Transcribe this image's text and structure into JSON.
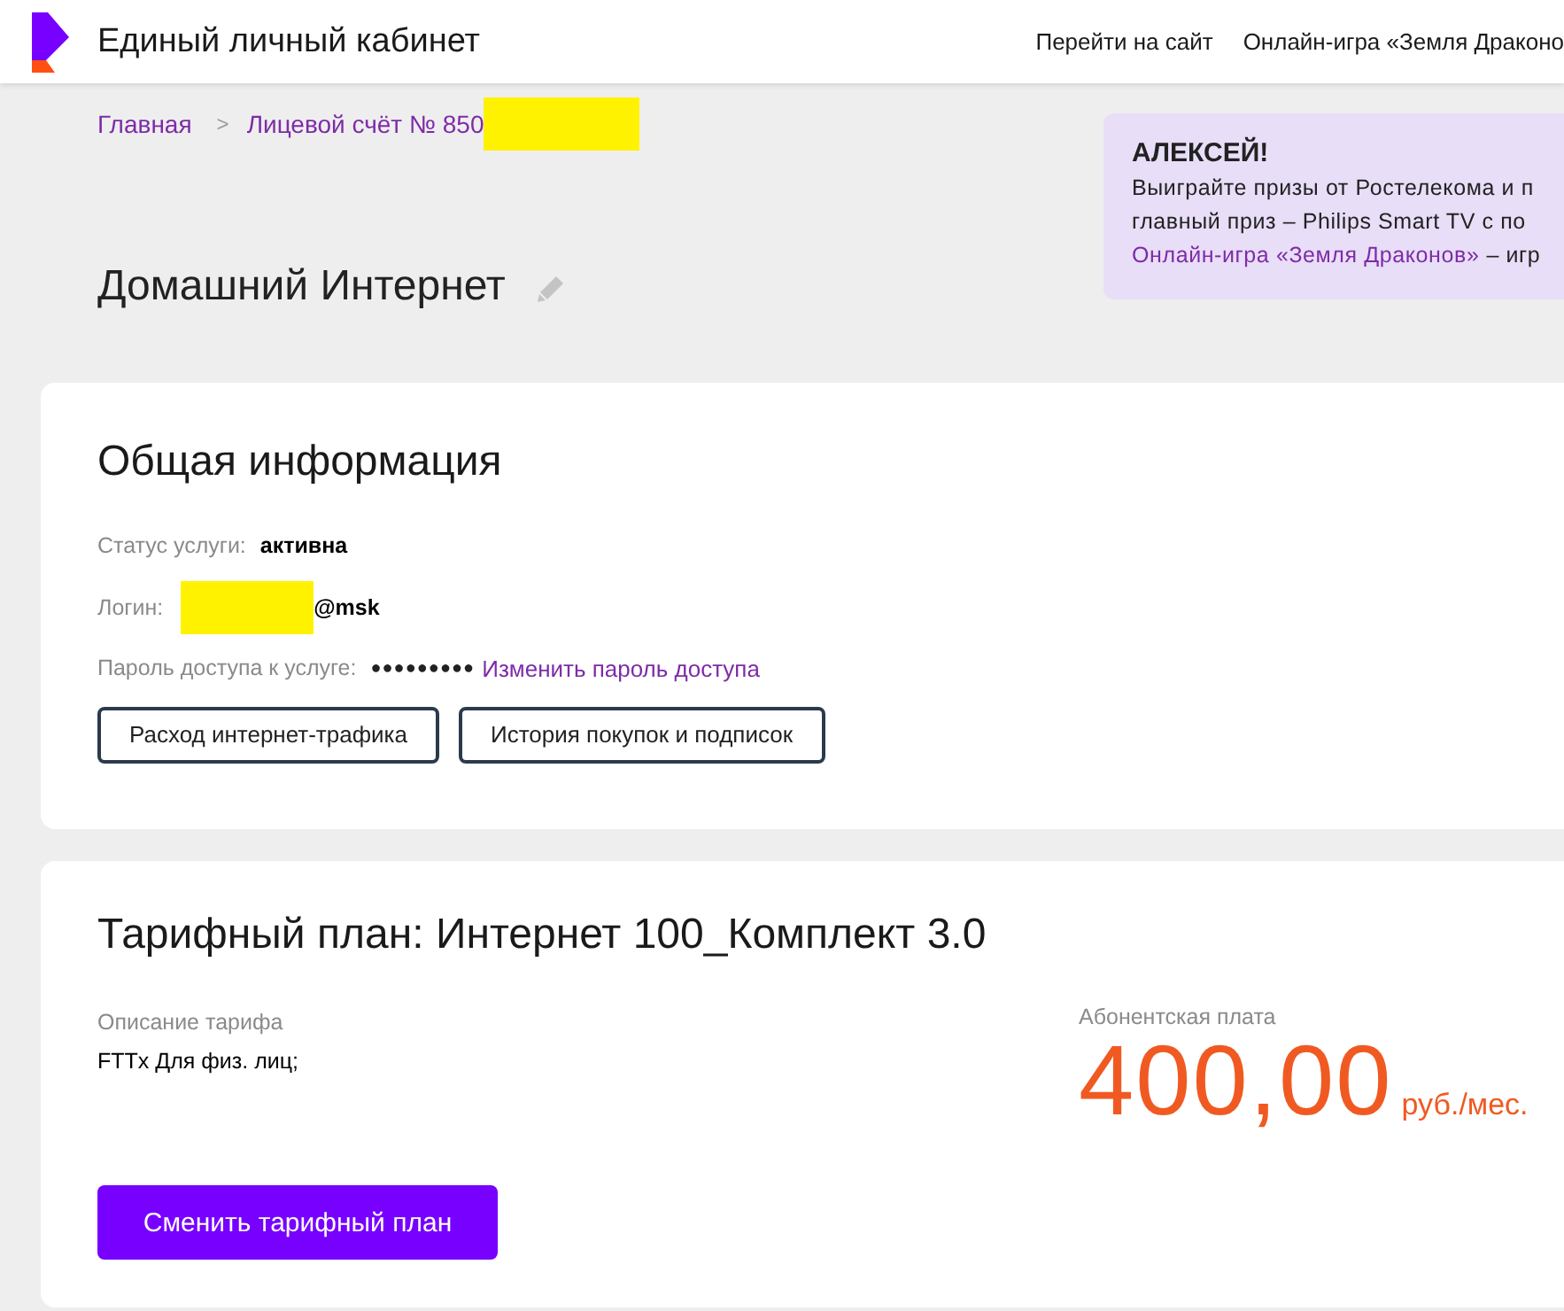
{
  "header": {
    "title": "Единый личный кабинет",
    "nav": [
      "Перейти на сайт",
      "Онлайн-игра «Земля Драконо"
    ]
  },
  "breadcrumbs": {
    "separator": ">",
    "items": [
      {
        "label": "Главная",
        "redacted": false
      },
      {
        "label": "Лицевой счёт № 850",
        "redacted": true
      }
    ]
  },
  "promo": {
    "title": "АЛЕКСЕЙ!",
    "lines": [
      "Выиграйте призы от Ростелекома и п",
      "главный приз – Philips Smart TV с по"
    ],
    "link": "Онлайн-игра «Земля Драконов»",
    "tail": "– игр"
  },
  "page_title": "Домашний Интернет",
  "general": {
    "title": "Общая информация",
    "fields": [
      {
        "kind": "text",
        "label": "Статус услуги:",
        "value": "активна"
      },
      {
        "kind": "login",
        "label": "Логин:",
        "value": "@msk",
        "redacted": true
      },
      {
        "kind": "password",
        "label": "Пароль доступа к услуге:",
        "value": "●●●●●●●●●",
        "link": "Изменить пароль доступа"
      }
    ],
    "buttons": [
      "Расход интернет-трафика",
      "История покупок и подписок"
    ]
  },
  "tariff": {
    "title": "Тарифный план: Интернет 100_Комплект 3.0",
    "description_label": "Описание тарифа",
    "description": "FTTx Для физ. лиц;",
    "fee_label": "Абонентская плата",
    "fee": "400,00",
    "fee_unit": "руб./мес.",
    "button": "Сменить тарифный план"
  }
}
